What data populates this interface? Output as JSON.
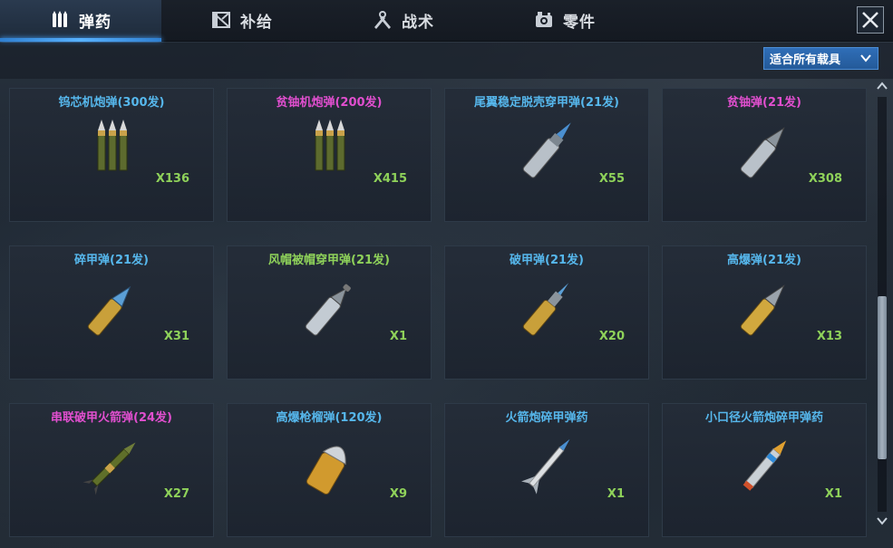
{
  "tabs": [
    {
      "label": "弹药",
      "icon": "ammo-icon",
      "active": true
    },
    {
      "label": "补给",
      "icon": "supply-crate-icon",
      "active": false
    },
    {
      "label": "战术",
      "icon": "tactics-icon",
      "active": false
    },
    {
      "label": "零件",
      "icon": "parts-icon",
      "active": false
    }
  ],
  "close_icon": "close-icon",
  "filter": {
    "selected": "适合所有载具",
    "icon": "chevron-down-icon"
  },
  "colors": {
    "blue_name": "#56b7ec",
    "pink_name": "#e14fcf",
    "green_name": "#8fd25a",
    "count": "#8fd25a",
    "accent": "#4aa3ff"
  },
  "items": [
    {
      "name": "钨芯机炮弹(300发)",
      "count": "X136",
      "color": "blue",
      "art": "triple-green-shells"
    },
    {
      "name": "贫铀机炮弹(200发)",
      "count": "X415",
      "color": "pink",
      "art": "triple-green-shells"
    },
    {
      "name": "尾翼稳定脱壳穿甲弹(21发)",
      "count": "X55",
      "color": "blue",
      "art": "silver-apfsds-shell"
    },
    {
      "name": "贫铀弹(21发)",
      "count": "X308",
      "color": "pink",
      "art": "silver-shell"
    },
    {
      "name": "碎甲弹(21发)",
      "count": "X31",
      "color": "blue",
      "art": "gold-shell-blue-tip"
    },
    {
      "name": "风帽被帽穿甲弹(21发)",
      "count": "X1",
      "color": "green",
      "art": "silver-capped-shell"
    },
    {
      "name": "破甲弹(21发)",
      "count": "X20",
      "color": "blue",
      "art": "gold-shell-needle-tip"
    },
    {
      "name": "高爆弹(21发)",
      "count": "X13",
      "color": "blue",
      "art": "gold-shell-silver-tip"
    },
    {
      "name": "串联破甲火箭弹(24发)",
      "count": "X27",
      "color": "pink",
      "art": "green-rocket"
    },
    {
      "name": "高爆枪榴弹(120发)",
      "count": "X9",
      "color": "blue",
      "art": "grenade-round"
    },
    {
      "name": "火箭炮碎甲弹药",
      "count": "X1",
      "color": "blue",
      "art": "finned-rocket"
    },
    {
      "name": "小口径火箭炮碎甲弹药",
      "count": "X1",
      "color": "blue",
      "art": "small-rocket"
    }
  ],
  "scrollbar": {
    "up_icon": "scroll-up-icon",
    "down_icon": "scroll-down-icon",
    "position": 0.5
  }
}
